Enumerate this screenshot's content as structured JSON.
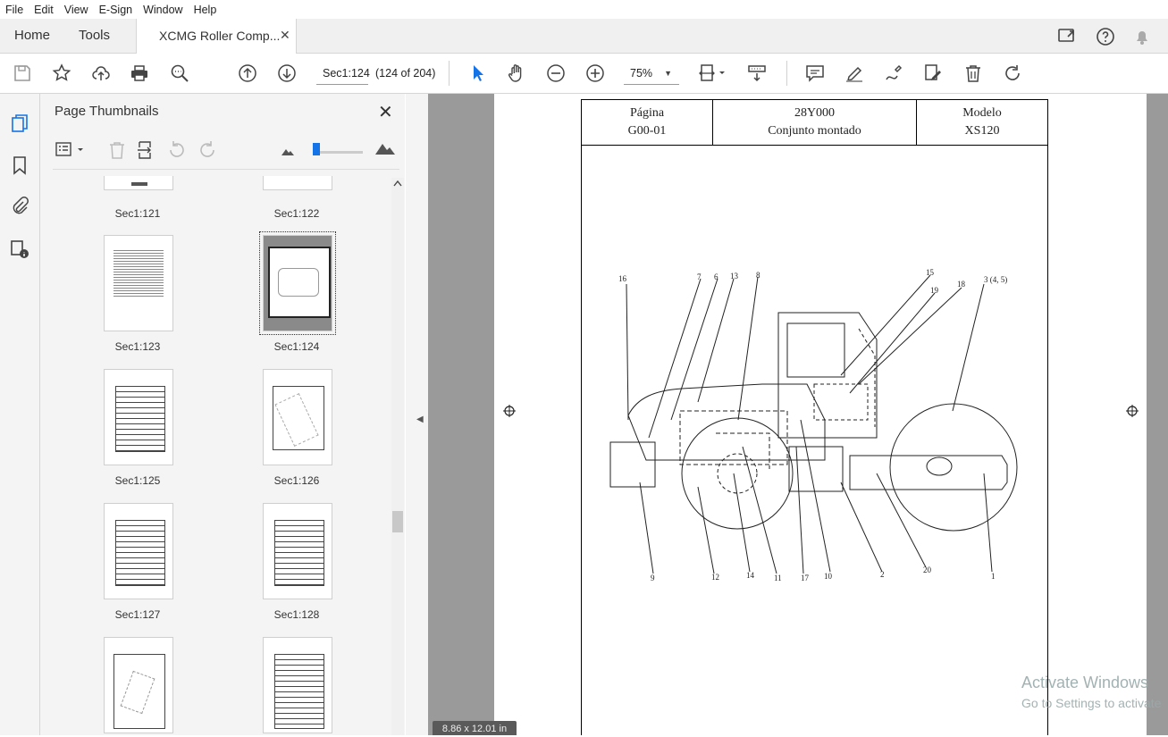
{
  "menu": [
    "File",
    "Edit",
    "View",
    "E-Sign",
    "Window",
    "Help"
  ],
  "tabs": {
    "home": "Home",
    "tools": "Tools",
    "document": "XCMG Roller Comp...",
    "close": "✕"
  },
  "toolbar": {
    "page_input": "Sec1:124",
    "page_count": "(124 of 204)",
    "zoom": "75%"
  },
  "sidebar": {
    "title": "Page Thumbnails",
    "close": "✕"
  },
  "thumbnails": [
    {
      "label": "Sec1:121"
    },
    {
      "label": "Sec1:122"
    },
    {
      "label": "Sec1:123"
    },
    {
      "label": "Sec1:124",
      "selected": true
    },
    {
      "label": "Sec1:125"
    },
    {
      "label": "Sec1:126"
    },
    {
      "label": "Sec1:127"
    },
    {
      "label": "Sec1:128"
    },
    {
      "label": ""
    },
    {
      "label": ""
    }
  ],
  "document": {
    "header": [
      {
        "line1": "Página",
        "line2": "G00-01"
      },
      {
        "line1": "28Y000",
        "line2": "Conjunto montado"
      },
      {
        "line1": "Modelo",
        "line2": "XS120"
      }
    ],
    "callouts": [
      "16",
      "7",
      "6",
      "13",
      "8",
      "15",
      "19",
      "18",
      "3 (4, 5)",
      "9",
      "12",
      "14",
      "11",
      "17",
      "10",
      "2",
      "20",
      "1"
    ]
  },
  "status": {
    "page_size": "8.86 x 12.01 in",
    "activate_title": "Activate Windows",
    "activate_sub": "Go to Settings to activate"
  }
}
